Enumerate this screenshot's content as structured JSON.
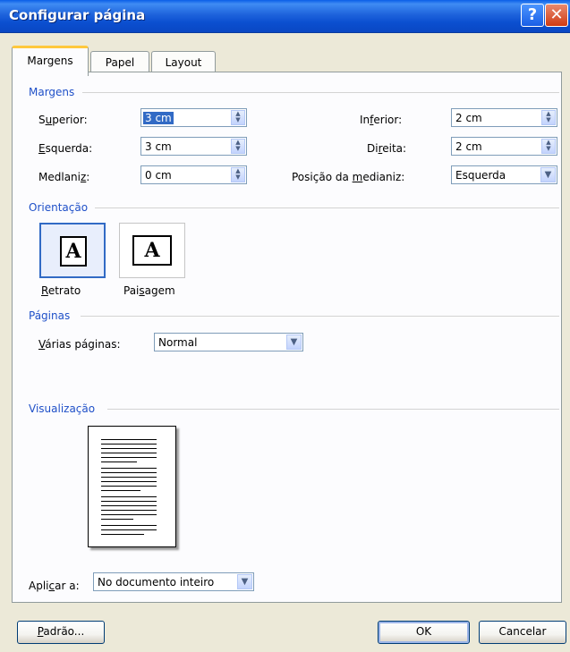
{
  "window": {
    "title": "Configurar página",
    "help_glyph": "?",
    "close_glyph": "✕"
  },
  "tabs": [
    {
      "label": "Margens",
      "active": true
    },
    {
      "label": "Papel",
      "active": false
    },
    {
      "label": "Layout",
      "active": false
    }
  ],
  "margins": {
    "group_label": "Margens",
    "superior": {
      "prefix": "S",
      "underline": "u",
      "suffix": "perior:",
      "value": "3 cm"
    },
    "inferior": {
      "prefix": "In",
      "underline": "f",
      "suffix": "erior:",
      "value": "2 cm"
    },
    "esquerda": {
      "prefix": "",
      "underline": "E",
      "suffix": "squerda:",
      "value": "3 cm"
    },
    "direita": {
      "prefix": "Di",
      "underline": "r",
      "suffix": "eita:",
      "value": "2 cm"
    },
    "medianiz": {
      "prefix": "Medlani",
      "underline": "z",
      "suffix": ":",
      "value": "0 cm"
    },
    "posicao": {
      "prefix": "Posição da ",
      "underline": "m",
      "suffix": "edianiz:",
      "value": "Esquerda"
    }
  },
  "orientation": {
    "group_label": "Orientação",
    "page_glyph": "A",
    "retrato": {
      "underline": "R",
      "suffix": "etrato",
      "selected": true
    },
    "paisagem": {
      "prefix": "Pai",
      "underline": "s",
      "suffix": "agem",
      "selected": false
    }
  },
  "pages": {
    "group_label": "Páginas",
    "label_underline": "V",
    "label_suffix": "árias páginas:",
    "value": "Normal"
  },
  "preview": {
    "group_label": "Visualização"
  },
  "apply": {
    "prefix": "Apli",
    "underline": "c",
    "suffix": "ar a:",
    "value": "No documento inteiro"
  },
  "buttons": {
    "default_underline": "P",
    "default_suffix": "adrão...",
    "ok": "OK",
    "cancel": "Cancelar"
  },
  "icons": {
    "spin": "spin-arrows-icon",
    "dropdown": "chevron-down-icon"
  },
  "colors": {
    "title_bar": "#0a47c3",
    "group_label": "#1f50c8",
    "dialog_bg": "#ece9d8",
    "selection": "#316ac5"
  }
}
